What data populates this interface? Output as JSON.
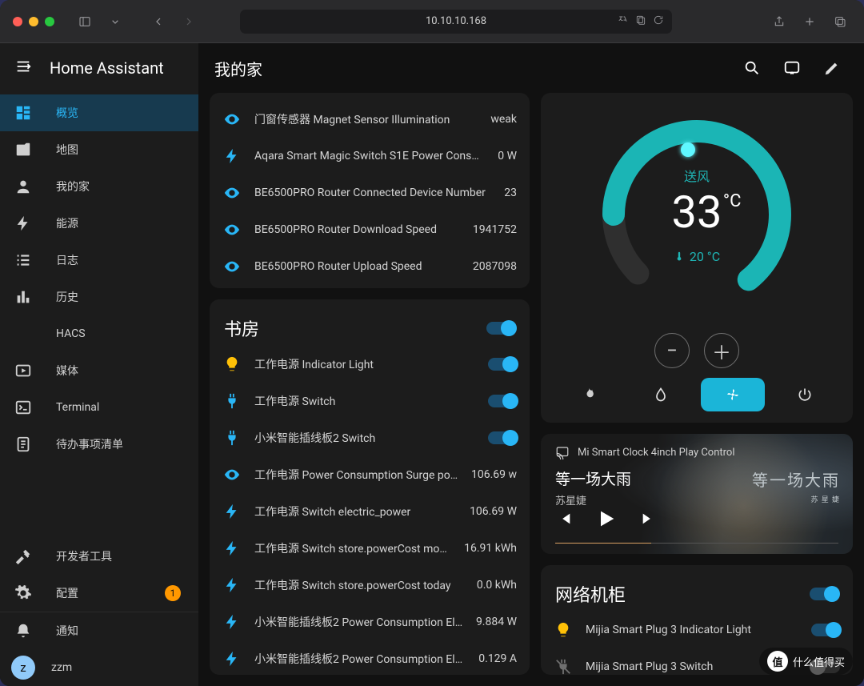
{
  "chrome": {
    "address": "10.10.10.168"
  },
  "app": {
    "title": "Home Assistant",
    "page_title": "我的家"
  },
  "sidebar": {
    "items": [
      {
        "label": "概览",
        "icon": "dashboard",
        "active": true
      },
      {
        "label": "地图",
        "icon": "map"
      },
      {
        "label": "我的家",
        "icon": "person"
      },
      {
        "label": "能源",
        "icon": "bolt"
      },
      {
        "label": "日志",
        "icon": "list"
      },
      {
        "label": "历史",
        "icon": "chart"
      },
      {
        "label": "HACS",
        "icon": ""
      },
      {
        "label": "媒体",
        "icon": "media"
      },
      {
        "label": "Terminal",
        "icon": "terminal"
      },
      {
        "label": "待办事项清单",
        "icon": "todo"
      }
    ],
    "dev": {
      "label": "开发者工具"
    },
    "settings": {
      "label": "配置",
      "badge": "1"
    },
    "notify": {
      "label": "通知"
    },
    "user": {
      "initial": "z",
      "name": "zzm"
    }
  },
  "overview": {
    "entities": [
      {
        "icon": "eye",
        "color": "blue",
        "name": "门窗传感器 Magnet Sensor Illumination",
        "value": "weak"
      },
      {
        "icon": "bolt",
        "color": "blue",
        "name": "Aqara Smart Magic Switch S1E Power Consu...",
        "value": "0 W"
      },
      {
        "icon": "eye",
        "color": "blue",
        "name": "BE6500PRO Router Connected Device Number",
        "value": "23"
      },
      {
        "icon": "eye",
        "color": "blue",
        "name": "BE6500PRO Router Download Speed",
        "value": "1941752"
      },
      {
        "icon": "eye",
        "color": "blue",
        "name": "BE6500PRO Router Upload Speed",
        "value": "2087098"
      }
    ]
  },
  "study": {
    "title": "书房",
    "entities": [
      {
        "icon": "bulb",
        "color": "yellow",
        "name": "工作电源 Indicator Light",
        "toggle": true
      },
      {
        "icon": "plug",
        "color": "blue",
        "name": "工作电源 Switch",
        "toggle": true
      },
      {
        "icon": "plug",
        "color": "blue",
        "name": "小米智能插线板2 Switch",
        "toggle": true
      },
      {
        "icon": "eye",
        "color": "blue",
        "name": "工作电源 Power Consumption Surge pow...",
        "value": "106.69 w"
      },
      {
        "icon": "bolt",
        "color": "blue",
        "name": "工作电源 Switch electric_power",
        "value": "106.69 W"
      },
      {
        "icon": "bolt",
        "color": "blue",
        "name": "工作电源 Switch store.powerCost month",
        "value": "16.91 kWh"
      },
      {
        "icon": "bolt",
        "color": "blue",
        "name": "工作电源 Switch store.powerCost today",
        "value": "0.0 kWh"
      },
      {
        "icon": "bolt",
        "color": "blue",
        "name": "小米智能插线板2 Power Consumption Ele...",
        "value": "9.884 W"
      },
      {
        "icon": "bolt",
        "color": "blue",
        "name": "小米智能插线板2 Power Consumption Elec...",
        "value": "0.129 A"
      }
    ]
  },
  "thermostat": {
    "mode": "送风",
    "target_temp": "33",
    "unit": "°C",
    "current_temp": "20 °C",
    "presets": [
      "heat",
      "dry",
      "fan",
      "power"
    ],
    "active_preset": 2,
    "accent_color": "#1bb5b5"
  },
  "media": {
    "source": "Mi Smart Clock 4inch Play Control",
    "title": "等一场大雨",
    "artist": "苏星婕",
    "overlay_text": "等一场大雨",
    "overlay_sub": "苏 星 婕",
    "progress_pct": 34
  },
  "cabinet": {
    "title": "网络机柜",
    "header_toggle": true,
    "entities": [
      {
        "icon": "bulb",
        "color": "yellow",
        "name": "Mijia Smart Plug 3 Indicator Light",
        "toggle": true
      },
      {
        "icon": "plug-off",
        "color": "grey",
        "name": "Mijia Smart Plug 3 Switch",
        "toggle": false
      }
    ]
  },
  "watermark": {
    "glyph": "值",
    "text": "什么值得买"
  }
}
